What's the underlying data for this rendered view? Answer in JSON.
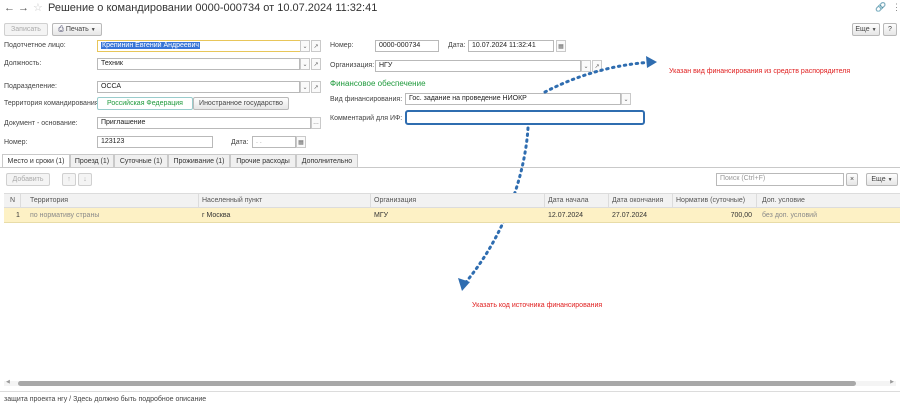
{
  "window": {
    "title": "Решение о командировании 0000-000734 от 10.07.2024 11:32:41"
  },
  "toolbar": {
    "save_label": "Записать",
    "print_label": "Печать",
    "more_label": "Еще",
    "help_label": "?"
  },
  "form": {
    "accountable_label": "Подотчетное лицо:",
    "accountable_value": "Крепинин Евгений Андреевич",
    "position_label": "Должность:",
    "position_value": "Техник",
    "department_label": "Подразделение:",
    "department_value": "ОССА",
    "territory_label": "Территория командирования:",
    "territory_options": [
      "Российская Федерация",
      "Иностранное государство"
    ],
    "basis_doc_label": "Документ - основание:",
    "basis_doc_value": "Приглашение",
    "number_label": "Номер:",
    "number_value": "123123",
    "basis_date_label": "Дата:",
    "basis_date_value": ".  .",
    "doc_number_label": "Номер:",
    "doc_number_value": "0000-000734",
    "doc_date_label": "Дата:",
    "doc_date_value": "10.07.2024 11:32:41",
    "organization_label": "Организация:",
    "organization_value": "НГУ",
    "financing_section_title": "Финансовое обеспечение",
    "financing_type_label": "Вид финансирования:",
    "financing_type_value": "Гос. задание на проведение НИОКР",
    "comment_label": "Комментарий для ИФ:",
    "comment_value": ""
  },
  "tabs": [
    "Место и сроки (1)",
    "Проезд (1)",
    "Суточные (1)",
    "Проживание (1)",
    "Прочие расходы",
    "Дополнительно"
  ],
  "table_toolbar": {
    "add_label": "Добавить",
    "search_placeholder": "Поиск (Ctrl+F)",
    "clear_label": "×",
    "more_label": "Еще"
  },
  "table": {
    "headers": [
      "N",
      "Территория",
      "Населенный пункт",
      "Организация",
      "Дата начала",
      "Дата окончания",
      "Норматив (суточные)",
      "Доп. условие"
    ],
    "rows": [
      [
        "1",
        "по нормативу страны",
        "г Москва",
        "МГУ",
        "12.07.2024",
        "27.07.2024",
        "700,00",
        "без доп. условий"
      ]
    ]
  },
  "footer": {
    "description": "защита проекта нгу / Здесь должно быть подробное описание"
  },
  "annotations": {
    "financing_note": "Указан вид финансирования из средств распорядителя",
    "source_code_note": "Указать код источника финансирования",
    "color": "#e02020",
    "arrow_color": "#2f6db0"
  },
  "colors": {
    "selected_row": "#fdf1c5",
    "accent_green": "#1f9a3c",
    "highlight_field": "#2f6db0"
  }
}
